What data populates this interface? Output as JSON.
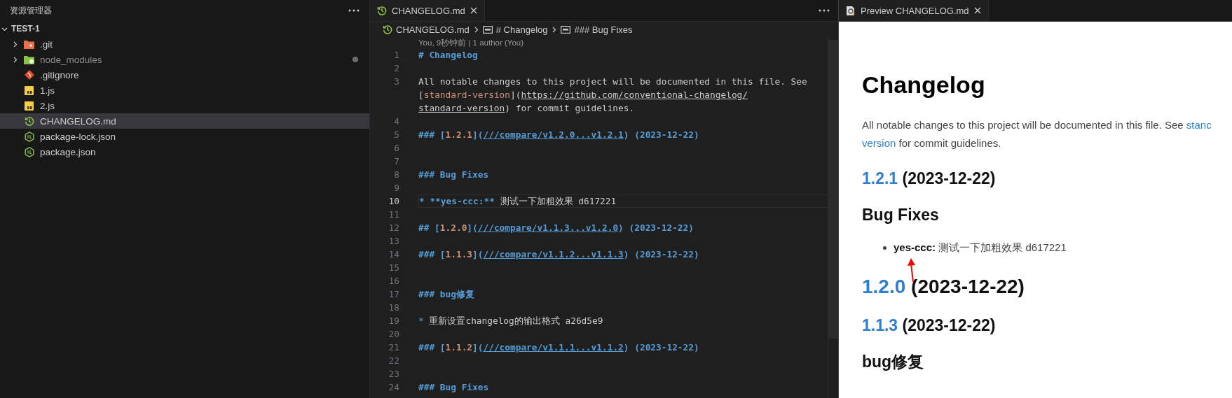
{
  "sidebar": {
    "title": "资源管理器",
    "root": {
      "label": "TEST-1",
      "expanded": true,
      "children": [
        {
          "label": ".git",
          "kind": "folder-git",
          "expanded": false,
          "dimmed": false,
          "selected": false
        },
        {
          "label": "node_modules",
          "kind": "folder-node",
          "expanded": false,
          "dimmed": true,
          "selected": false
        },
        {
          "label": ".gitignore",
          "kind": "git",
          "dimmed": false,
          "selected": false
        },
        {
          "label": "1.js",
          "kind": "js",
          "dimmed": false,
          "selected": false
        },
        {
          "label": "2.js",
          "kind": "js",
          "dimmed": false,
          "selected": false
        },
        {
          "label": "CHANGELOG.md",
          "kind": "history",
          "dimmed": false,
          "selected": true
        },
        {
          "label": "package-lock.json",
          "kind": "node",
          "dimmed": false,
          "selected": false
        },
        {
          "label": "package.json",
          "kind": "node",
          "dimmed": false,
          "selected": false
        }
      ]
    }
  },
  "editor": {
    "tab": {
      "label": "CHANGELOG.md"
    },
    "breadcrumb": [
      "CHANGELOG.md",
      "# Changelog",
      "### Bug Fixes"
    ],
    "codelens": "You, 9秒钟前 | 1 author (You)",
    "lines": [
      {
        "number": "1",
        "current": false,
        "tokens": [
          {
            "kind": "heading",
            "text": "# Changelog"
          }
        ]
      },
      {
        "number": "2",
        "current": false
      },
      {
        "number": "3",
        "current": false,
        "tokens": [
          {
            "kind": "plain",
            "text": "All notable changes to this project will be documented in this file. See"
          },
          {
            "kind": "wrap"
          },
          {
            "kind": "plain",
            "text": "["
          },
          {
            "kind": "label",
            "text": "standard-version"
          },
          {
            "kind": "plain",
            "text": "]("
          },
          {
            "kind": "link",
            "text": "https://github.com/conventional-changelog/"
          },
          {
            "kind": "wrap"
          },
          {
            "kind": "link",
            "text": "standard-version"
          },
          {
            "kind": "plain",
            "text": ") for commit guidelines."
          }
        ]
      },
      {
        "number": "4",
        "current": false
      },
      {
        "number": "5",
        "current": false,
        "tokens": [
          {
            "kind": "heading",
            "text": "### ["
          },
          {
            "kind": "heading-label",
            "text": "1.2.1"
          },
          {
            "kind": "heading",
            "text": "]("
          },
          {
            "kind": "heading-link",
            "text": "///compare/v1.2.0...v1.2.1"
          },
          {
            "kind": "heading",
            "text": ") (2023-12-22)"
          }
        ]
      },
      {
        "number": "6",
        "current": false
      },
      {
        "number": "7",
        "current": false
      },
      {
        "number": "8",
        "current": false,
        "tokens": [
          {
            "kind": "heading",
            "text": "### Bug Fixes"
          }
        ]
      },
      {
        "number": "9",
        "current": false
      },
      {
        "number": "10",
        "current": true,
        "tokens": [
          {
            "kind": "heading",
            "text": "* **yes-ccc:**"
          },
          {
            "kind": "plain",
            "text": " 测试一下加粗效果 d617221"
          }
        ]
      },
      {
        "number": "11",
        "current": false
      },
      {
        "number": "12",
        "current": false,
        "tokens": [
          {
            "kind": "heading",
            "text": "## ["
          },
          {
            "kind": "heading-label",
            "text": "1.2.0"
          },
          {
            "kind": "heading",
            "text": "]("
          },
          {
            "kind": "heading-link",
            "text": "///compare/v1.1.3...v1.2.0"
          },
          {
            "kind": "heading",
            "text": ") (2023-12-22)"
          }
        ]
      },
      {
        "number": "13",
        "current": false
      },
      {
        "number": "14",
        "current": false,
        "tokens": [
          {
            "kind": "heading",
            "text": "### ["
          },
          {
            "kind": "heading-label",
            "text": "1.1.3"
          },
          {
            "kind": "heading",
            "text": "]("
          },
          {
            "kind": "heading-link",
            "text": "///compare/v1.1.2...v1.1.3"
          },
          {
            "kind": "heading",
            "text": ") (2023-12-22)"
          }
        ]
      },
      {
        "number": "15",
        "current": false
      },
      {
        "number": "16",
        "current": false
      },
      {
        "number": "17",
        "current": false,
        "tokens": [
          {
            "kind": "heading",
            "text": "### bug修复"
          }
        ]
      },
      {
        "number": "18",
        "current": false
      },
      {
        "number": "19",
        "current": false,
        "tokens": [
          {
            "kind": "markup",
            "text": "*"
          },
          {
            "kind": "plain",
            "text": " 重新设置changelog的输出格式 a26d5e9"
          }
        ]
      },
      {
        "number": "20",
        "current": false
      },
      {
        "number": "21",
        "current": false,
        "tokens": [
          {
            "kind": "heading",
            "text": "### ["
          },
          {
            "kind": "heading-label",
            "text": "1.1.2"
          },
          {
            "kind": "heading",
            "text": "]("
          },
          {
            "kind": "heading-link",
            "text": "///compare/v1.1.1...v1.1.2"
          },
          {
            "kind": "heading",
            "text": ") (2023-12-22)"
          }
        ]
      },
      {
        "number": "22",
        "current": false
      },
      {
        "number": "23",
        "current": false
      },
      {
        "number": "24",
        "current": false,
        "tokens": [
          {
            "kind": "heading",
            "text": "### Bug Fixes"
          }
        ]
      }
    ]
  },
  "preview": {
    "tab": {
      "label": "Preview CHANGELOG.md"
    },
    "blocks": [
      {
        "kind": "h1",
        "text": "Changelog"
      },
      {
        "kind": "p",
        "parts": [
          {
            "kind": "text",
            "text": "All notable changes to this project will be documented in this file. See "
          },
          {
            "kind": "link",
            "text": "stanc"
          },
          {
            "kind": "break"
          },
          {
            "kind": "link",
            "text": "version"
          },
          {
            "kind": "text",
            "text": " for commit guidelines."
          }
        ]
      },
      {
        "kind": "h3",
        "link": "1.2.1",
        "text": " (2023-12-22)"
      },
      {
        "kind": "h3",
        "text": "Bug Fixes"
      },
      {
        "kind": "li",
        "text": "**yes-ccc:** 测试一下加粗效果 d617221"
      },
      {
        "kind": "arrow"
      },
      {
        "kind": "h2",
        "link": "1.2.0",
        "text": " (2023-12-22)"
      },
      {
        "kind": "h3",
        "link": "1.1.3",
        "text": " (2023-12-22)"
      },
      {
        "kind": "h3",
        "text": "bug修复"
      }
    ]
  }
}
